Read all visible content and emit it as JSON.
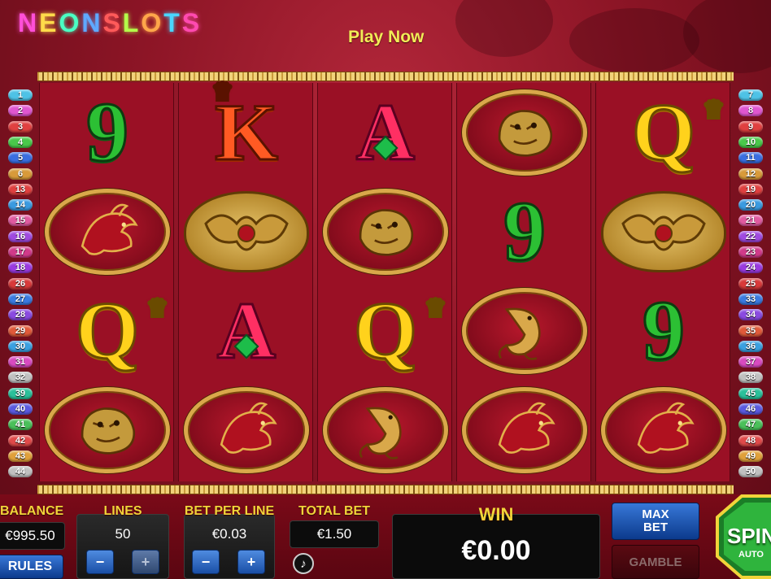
{
  "brand": {
    "letters": [
      "N",
      "E",
      "O",
      "N",
      "S",
      "L",
      "O",
      "T",
      "S"
    ],
    "colors": [
      "#ff4fd8",
      "#ffdb4a",
      "#4affc3",
      "#5fa8ff",
      "#ff5a5a",
      "#b4ff4a",
      "#ffa64a",
      "#4ad6ff",
      "#ff4ab0"
    ]
  },
  "header": {
    "play_now": "Play Now"
  },
  "reels": [
    [
      "nine",
      "phoenix",
      "queen",
      "tiger"
    ],
    [
      "king",
      "bat",
      "ace",
      "phoenix"
    ],
    [
      "ace",
      "tiger",
      "queen",
      "koi"
    ],
    [
      "tiger",
      "nine",
      "koi",
      "phoenix"
    ],
    [
      "queen",
      "bat",
      "nine",
      "phoenix"
    ]
  ],
  "symbols": {
    "nine": "9",
    "king": "K",
    "ace": "A",
    "queen": "Q"
  },
  "paylines": {
    "left": [
      "1",
      "2",
      "3",
      "4",
      "5",
      "6",
      "13",
      "14",
      "15",
      "16",
      "17",
      "18",
      "26",
      "27",
      "28",
      "29",
      "30",
      "31",
      "32",
      "39",
      "40",
      "41",
      "42",
      "43",
      "44"
    ],
    "right": [
      "7",
      "8",
      "9",
      "10",
      "11",
      "12",
      "19",
      "20",
      "21",
      "22",
      "23",
      "24",
      "25",
      "33",
      "34",
      "35",
      "36",
      "37",
      "38",
      "45",
      "46",
      "47",
      "48",
      "49",
      "50"
    ],
    "colors": [
      "#4ec2e6",
      "#e056d0",
      "#e04040",
      "#49c84a",
      "#3a6ee0",
      "#d89a3a",
      "#e04040",
      "#3a9ae0",
      "#e05aa0",
      "#a04ae0",
      "#d03a8a",
      "#9a3ae0",
      "#d83a3a",
      "#3a7ae0",
      "#8a4ae0",
      "#e05a3a",
      "#3aa0e0",
      "#d84ac0",
      "#c0c0c0",
      "#2ac09a",
      "#5a5ae0",
      "#4ac05a",
      "#e04a4a",
      "#e0a03a",
      "#c0c0c0"
    ]
  },
  "panel": {
    "balance_label": "BALANCE",
    "balance_value": "€995.50",
    "lines_label": "LINES",
    "lines_value": "50",
    "bet_label": "BET PER LINE",
    "bet_value": "€0.03",
    "total_label": "TOTAL BET",
    "total_value": "€1.50",
    "win_label": "WIN",
    "win_value": "€0.00",
    "rules": "RULES",
    "max_bet": "MAX BET",
    "gamble": "GAMBLE",
    "spin": "SPIN",
    "auto": "AUTO",
    "minus": "−",
    "plus": "+",
    "music_icon": "music-note-icon"
  }
}
